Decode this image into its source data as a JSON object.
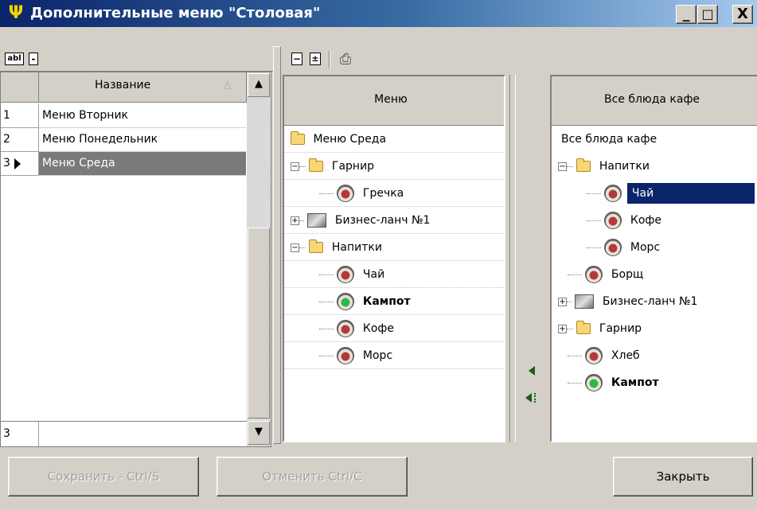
{
  "window": {
    "title": "Дополнительные меню \"Столовая\""
  },
  "title_buttons": [
    "_",
    "□",
    "X"
  ],
  "left_toolbar": {
    "edit_icon": "abl",
    "remove_icon": "-"
  },
  "grid": {
    "column_header": "Название",
    "sort_indicator": "△",
    "rows": [
      {
        "num": "1",
        "name": "Меню Вторник",
        "selected": false
      },
      {
        "num": "2",
        "name": "Меню Понедельник",
        "selected": false
      },
      {
        "num": "3",
        "name": "Меню Среда",
        "selected": true
      }
    ],
    "footer_num": "3"
  },
  "menu_pane": {
    "header": "Меню",
    "items": [
      {
        "label": "Меню Среда",
        "icon": "folder-icon",
        "level": 0,
        "bold": false
      },
      {
        "label": "Гарнир",
        "icon": "folder-icon",
        "level": 1,
        "expander": "-",
        "bold": false
      },
      {
        "label": "Гречка",
        "icon": "dish-icon",
        "level": 2,
        "bold": false
      },
      {
        "label": "Бизнес-ланч №1",
        "icon": "combo-icon",
        "level": 1,
        "expander": "+",
        "bold": false
      },
      {
        "label": "Напитки",
        "icon": "folder-icon",
        "level": 1,
        "expander": "-",
        "bold": false
      },
      {
        "label": "Чай",
        "icon": "dish-icon",
        "level": 2,
        "bold": false
      },
      {
        "label": "Кампот",
        "icon": "dish-green-icon",
        "level": 2,
        "bold": true
      },
      {
        "label": "Кофе",
        "icon": "dish-icon",
        "level": 2,
        "bold": false
      },
      {
        "label": "Морс",
        "icon": "dish-icon",
        "level": 2,
        "bold": false
      }
    ]
  },
  "dishes_pane": {
    "header": "Все блюда кафе",
    "items": [
      {
        "label": "Все блюда кафе",
        "icon": "",
        "level": 0,
        "bold": false
      },
      {
        "label": "Напитки",
        "icon": "folder-icon",
        "level": 1,
        "expander": "-",
        "bold": false
      },
      {
        "label": "Чай",
        "icon": "dish-icon",
        "level": 2,
        "bold": false,
        "selected": true
      },
      {
        "label": "Кофе",
        "icon": "dish-icon",
        "level": 2,
        "bold": false
      },
      {
        "label": "Морс",
        "icon": "dish-icon",
        "level": 2,
        "bold": false
      },
      {
        "label": "Борщ",
        "icon": "dish-icon",
        "level": 1,
        "bold": false
      },
      {
        "label": "Бизнес-ланч №1",
        "icon": "combo-icon",
        "level": 1,
        "expander": "+",
        "bold": false
      },
      {
        "label": "Гарнир",
        "icon": "folder-icon",
        "level": 1,
        "expander": "+",
        "bold": false
      },
      {
        "label": "Хлеб",
        "icon": "dish-icon",
        "level": 1,
        "bold": false
      },
      {
        "label": "Кампот",
        "icon": "dish-green-icon",
        "level": 1,
        "bold": true
      }
    ]
  },
  "buttons": {
    "save": "Сохранить - Ctrl/S",
    "cancel": "Отменить Ctrl/C",
    "close": "Закрыть"
  },
  "colors": {
    "title_start": "#0a246a",
    "title_end": "#a6caf0",
    "selection": "#0a246a",
    "grid_selection": "#7a7a7a"
  }
}
